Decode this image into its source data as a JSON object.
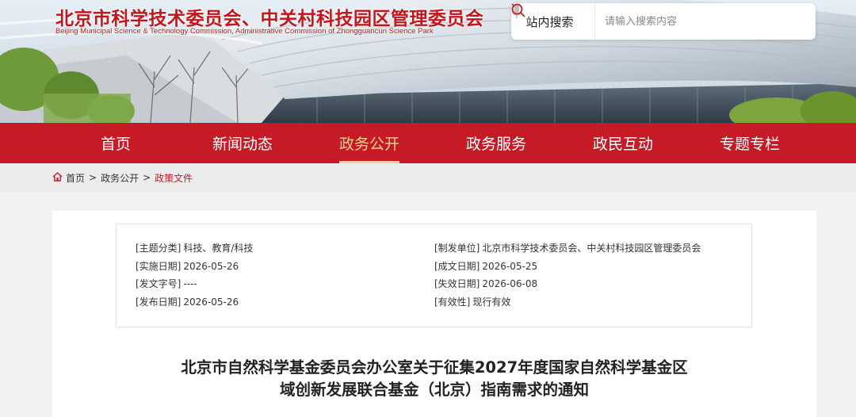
{
  "header": {
    "title": "北京市科学技术委员会、中关村科技园区管理委员会",
    "subtitle": "Beijing Municipal Science & Technology Commission, Administrative Commission of Zhongguancun Science Park"
  },
  "search": {
    "scope_label": "站内搜索",
    "placeholder": "请输入搜索内容",
    "icons": [
      "chevron-down-icon",
      "microphone-icon",
      "search-icon"
    ]
  },
  "nav": {
    "items": [
      {
        "label": "首页"
      },
      {
        "label": "新闻动态"
      },
      {
        "label": "政务公开",
        "active": true
      },
      {
        "label": "政务服务"
      },
      {
        "label": "政民互动"
      },
      {
        "label": "专题专栏"
      }
    ],
    "accent_color": "#c61a27",
    "active_color": "#f7d48b"
  },
  "breadcrumb": {
    "icon": "home-icon",
    "items": [
      "首页",
      "政务公开",
      "政策文件"
    ],
    "separator": ">"
  },
  "meta": {
    "left": [
      {
        "key": "[主题分类]",
        "value": "科技、教育/科技"
      },
      {
        "key": "[实施日期]",
        "value": "2026-05-26"
      },
      {
        "key": "[发文字号]",
        "value": "----"
      },
      {
        "key": "[发布日期]",
        "value": "2026-05-26"
      }
    ],
    "right": [
      {
        "key": "[制发单位]",
        "value": "北京市科学技术委员会、中关村科技园区管理委员会"
      },
      {
        "key": "[成文日期]",
        "value": "2026-05-25"
      },
      {
        "key": "[失效日期]",
        "value": "2026-06-08"
      },
      {
        "key": "[有效性]",
        "value": "现行有效"
      }
    ]
  },
  "document": {
    "title_line1": "北京市自然科学基金委员会办公室关于征集2027年度国家自然科学基金区",
    "title_line2": "域创新发展联合基金（北京）指南需求的通知"
  }
}
